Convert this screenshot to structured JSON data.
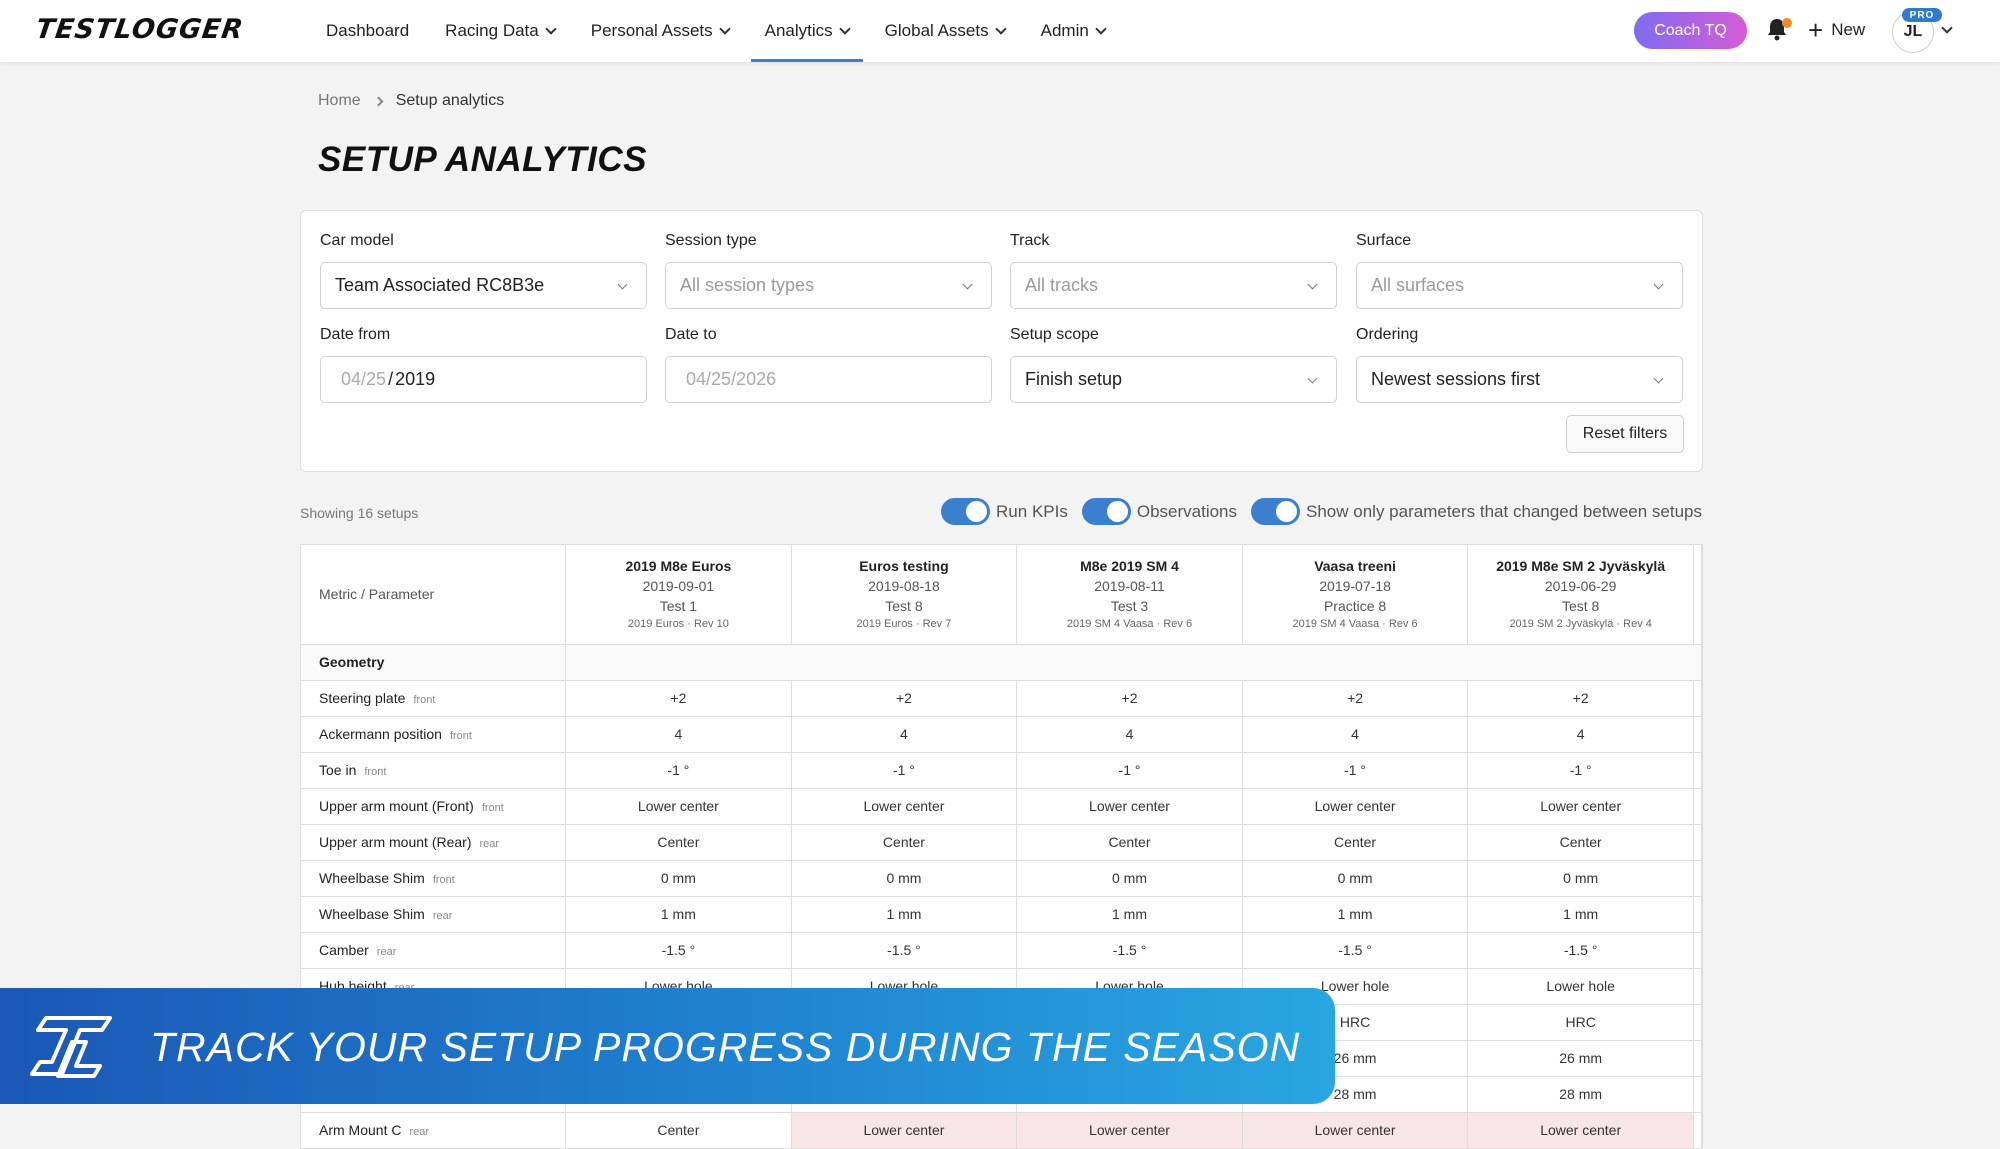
{
  "app": {
    "logo": "TESTLOGGER"
  },
  "nav": {
    "items": [
      {
        "label": "Dashboard",
        "dropdown": false,
        "active": false
      },
      {
        "label": "Racing Data",
        "dropdown": true,
        "active": false
      },
      {
        "label": "Personal Assets",
        "dropdown": true,
        "active": false
      },
      {
        "label": "Analytics",
        "dropdown": true,
        "active": true
      },
      {
        "label": "Global Assets",
        "dropdown": true,
        "active": false
      },
      {
        "label": "Admin",
        "dropdown": true,
        "active": false
      }
    ],
    "coach_label": "Coach TQ",
    "new_label": "New",
    "avatar_initials": "JL",
    "badge": "PRO",
    "notification_icon": "bell-icon"
  },
  "breadcrumb": {
    "home": "Home",
    "current": "Setup analytics"
  },
  "page_title": "SETUP ANALYTICS",
  "filters": {
    "car_model": {
      "label": "Car model",
      "value": "Team Associated RC8B3e"
    },
    "session_type": {
      "label": "Session type",
      "placeholder": "All session types"
    },
    "track": {
      "label": "Track",
      "placeholder": "All tracks"
    },
    "surface": {
      "label": "Surface",
      "placeholder": "All surfaces"
    },
    "date_from": {
      "label": "Date from",
      "month": "04",
      "day": "25",
      "year": "2019"
    },
    "date_to": {
      "label": "Date to",
      "month": "04",
      "day": "25",
      "year": "2026"
    },
    "setup_scope": {
      "label": "Setup scope",
      "value": "Finish setup"
    },
    "ordering": {
      "label": "Ordering",
      "value": "Newest sessions first"
    },
    "reset_label": "Reset filters"
  },
  "showing_text": "Showing 16 setups",
  "toggles": [
    {
      "label": "Run KPIs",
      "on": true
    },
    {
      "label": "Observations",
      "on": true
    },
    {
      "label": "Show only parameters that changed between setups",
      "on": true
    }
  ],
  "table": {
    "metric_header": "Metric / Parameter",
    "setups": [
      {
        "name": "2019 M8e Euros",
        "date": "2019-09-01",
        "session": "Test 1",
        "event": "2019 Euros · Rev 10"
      },
      {
        "name": "Euros testing",
        "date": "2019-08-18",
        "session": "Test 8",
        "event": "2019 Euros · Rev 7"
      },
      {
        "name": "M8e 2019 SM 4",
        "date": "2019-08-11",
        "session": "Test 3",
        "event": "2019 SM 4 Vaasa · Rev 6"
      },
      {
        "name": "Vaasa treeni",
        "date": "2019-07-18",
        "session": "Practice 8",
        "event": "2019 SM 4 Vaasa · Rev 6"
      },
      {
        "name": "2019 M8e SM 2 Jyväskylä",
        "date": "2019-06-29",
        "session": "Test 8",
        "event": "2019 SM 2 Jyväskylä · Rev 4"
      }
    ],
    "group": "Geometry",
    "rows": [
      {
        "param": "Steering plate",
        "pos": "front",
        "values": [
          "+2",
          "+2",
          "+2",
          "+2",
          "+2"
        ],
        "changed": [
          false,
          false,
          false,
          false,
          false
        ]
      },
      {
        "param": "Ackermann position",
        "pos": "front",
        "values": [
          "4",
          "4",
          "4",
          "4",
          "4"
        ],
        "changed": [
          false,
          false,
          false,
          false,
          false
        ]
      },
      {
        "param": "Toe in",
        "pos": "front",
        "values": [
          "-1 °",
          "-1 °",
          "-1 °",
          "-1 °",
          "-1 °"
        ],
        "changed": [
          false,
          false,
          false,
          false,
          false
        ]
      },
      {
        "param": "Upper arm mount (Front)",
        "pos": "front",
        "values": [
          "Lower center",
          "Lower center",
          "Lower center",
          "Lower center",
          "Lower center"
        ],
        "changed": [
          false,
          false,
          false,
          false,
          false
        ]
      },
      {
        "param": "Upper arm mount (Rear)",
        "pos": "rear",
        "values": [
          "Center",
          "Center",
          "Center",
          "Center",
          "Center"
        ],
        "changed": [
          false,
          false,
          false,
          false,
          false
        ]
      },
      {
        "param": "Wheelbase Shim",
        "pos": "front",
        "values": [
          "0 mm",
          "0 mm",
          "0 mm",
          "0 mm",
          "0 mm"
        ],
        "changed": [
          false,
          false,
          false,
          false,
          false
        ]
      },
      {
        "param": "Wheelbase Shim",
        "pos": "rear",
        "values": [
          "1 mm",
          "1 mm",
          "1 mm",
          "1 mm",
          "1 mm"
        ],
        "changed": [
          false,
          false,
          false,
          false,
          false
        ]
      },
      {
        "param": "Camber",
        "pos": "rear",
        "values": [
          "-1.5 °",
          "-1.5 °",
          "-1.5 °",
          "-1.5 °",
          "-1.5 °"
        ],
        "changed": [
          false,
          false,
          false,
          false,
          false
        ]
      },
      {
        "param": "Hub height",
        "pos": "rear",
        "values": [
          "Lower hole",
          "Lower hole",
          "Lower hole",
          "Lower hole",
          "Lower hole"
        ],
        "changed": [
          false,
          false,
          false,
          false,
          false
        ]
      },
      {
        "param": "",
        "pos": "",
        "values": [
          "",
          "",
          "",
          "HRC",
          "HRC"
        ],
        "changed": [
          false,
          false,
          false,
          false,
          false
        ]
      },
      {
        "param": "",
        "pos": "",
        "values": [
          "",
          "",
          "",
          "26 mm",
          "26 mm"
        ],
        "changed": [
          false,
          false,
          false,
          false,
          false
        ]
      },
      {
        "param": "",
        "pos": "",
        "values": [
          "",
          "",
          "",
          "28 mm",
          "28 mm"
        ],
        "changed": [
          false,
          false,
          false,
          false,
          false
        ]
      },
      {
        "param": "Arm Mount C",
        "pos": "rear",
        "values": [
          "Center",
          "Lower center",
          "Lower center",
          "Lower center",
          "Lower center"
        ],
        "changed": [
          false,
          true,
          true,
          true,
          true
        ]
      }
    ]
  },
  "banner": {
    "text": "TRACK YOUR SETUP PROGRESS DURING THE SEASON"
  }
}
